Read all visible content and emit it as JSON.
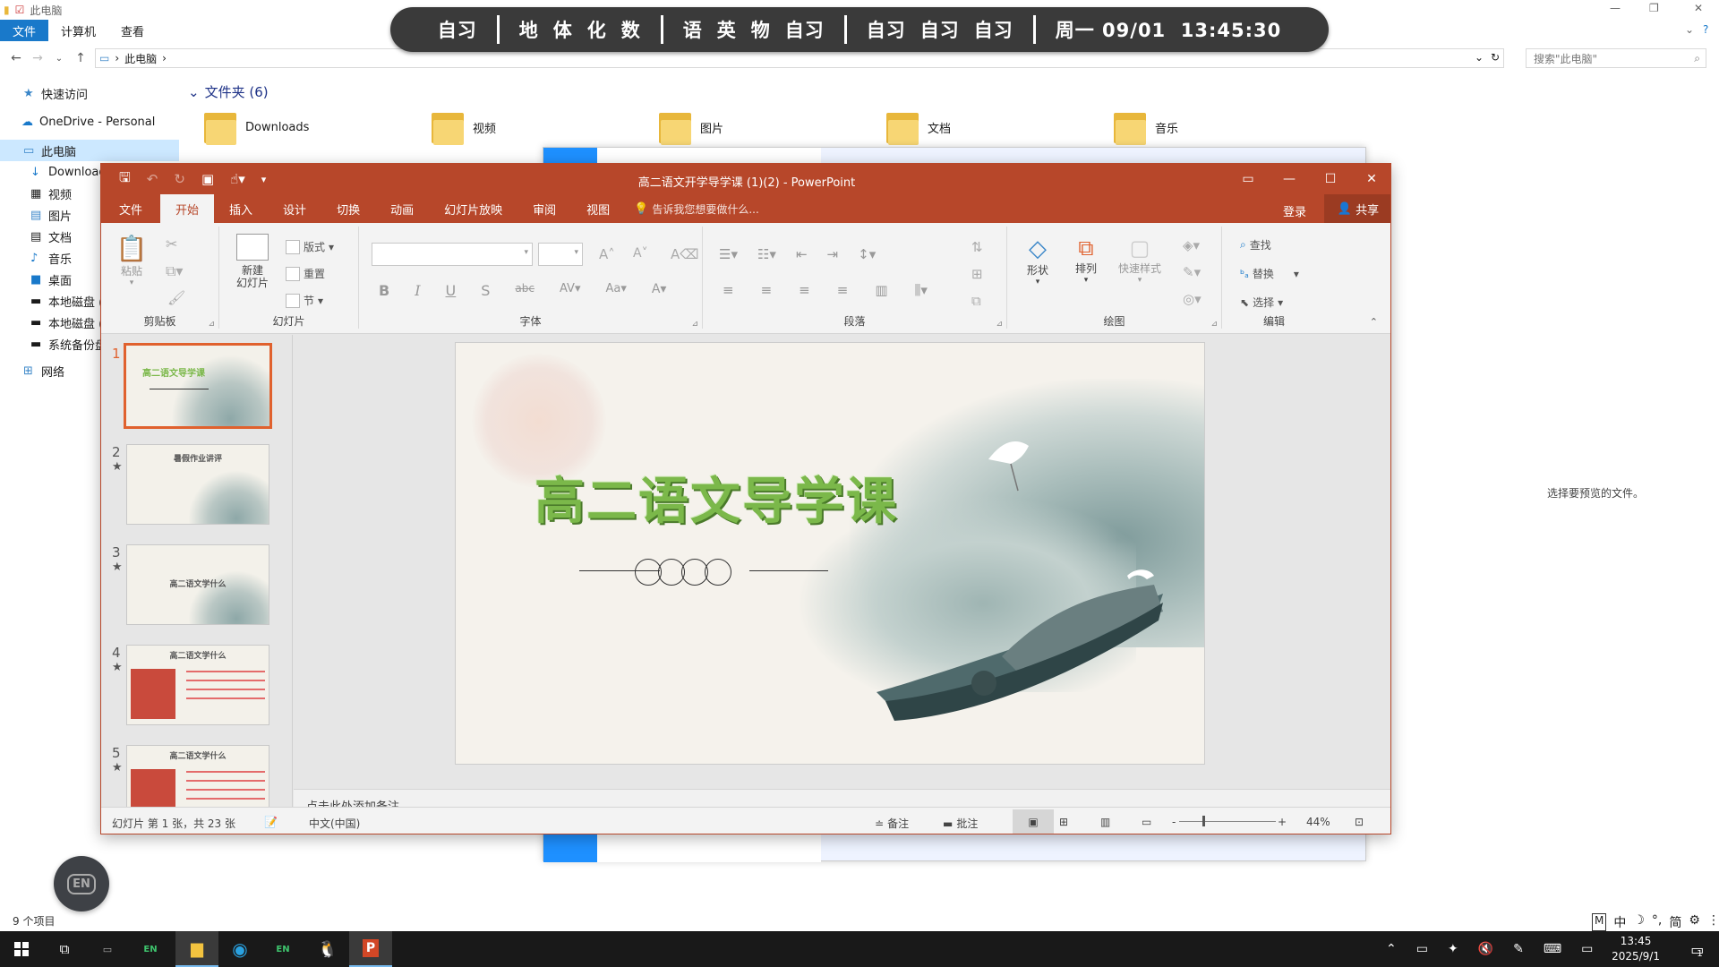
{
  "explorer": {
    "title": "此电脑",
    "tabs": [
      "文件",
      "计算机",
      "查看"
    ],
    "address": "此电脑",
    "search_placeholder": "搜索\"此电脑\"",
    "nav": [
      {
        "label": "快速访问",
        "icon": "star-icon"
      },
      {
        "label": "OneDrive - Personal",
        "icon": "cloud-icon"
      },
      {
        "label": "此电脑",
        "icon": "computer-icon"
      },
      {
        "label": "Download",
        "icon": "download-icon"
      },
      {
        "label": "视频",
        "icon": "video-icon"
      },
      {
        "label": "图片",
        "icon": "picture-icon"
      },
      {
        "label": "文档",
        "icon": "document-icon"
      },
      {
        "label": "音乐",
        "icon": "music-icon"
      },
      {
        "label": "桌面",
        "icon": "desktop-icon"
      },
      {
        "label": "本地磁盘 (C",
        "icon": "drive-icon"
      },
      {
        "label": "本地磁盘 (D",
        "icon": "drive-icon"
      },
      {
        "label": "系统备份盘",
        "icon": "drive-icon"
      },
      {
        "label": "网络",
        "icon": "network-icon"
      }
    ],
    "folders_header": "文件夹 (6)",
    "folders": [
      "Downloads",
      "视频",
      "图片",
      "文档",
      "音乐"
    ],
    "preview_message": "选择要预览的文件。",
    "item_count": "9 个项目"
  },
  "banner": {
    "groups": [
      [
        "自习"
      ],
      [
        "地",
        "体",
        "化",
        "数"
      ],
      [
        "语",
        "英",
        "物",
        "自习"
      ],
      [
        "自习",
        "自习",
        "自习"
      ]
    ],
    "datetime": "周一 09/01  13:45:30"
  },
  "ppt": {
    "title": "高二语文开学导学课 (1)(2) - PowerPoint",
    "tabs": [
      "文件",
      "开始",
      "插入",
      "设计",
      "切换",
      "动画",
      "幻灯片放映",
      "审阅",
      "视图"
    ],
    "active_tab": "开始",
    "tell_me": "告诉我您想要做什么...",
    "login": "登录",
    "share": "共享",
    "ribbon": {
      "clipboard": {
        "name": "剪贴板",
        "paste": "粘贴"
      },
      "slides": {
        "name": "幻灯片",
        "new_slide": "新建\n幻灯片",
        "layout": "版式",
        "reset": "重置",
        "section": "节"
      },
      "font": {
        "name": "字体"
      },
      "paragraph": {
        "name": "段落"
      },
      "drawing": {
        "name": "绘图",
        "shapes": "形状",
        "arrange": "排列",
        "quick_styles": "快速样式"
      },
      "editing": {
        "name": "编辑",
        "find": "查找",
        "replace": "替换",
        "select": "选择"
      }
    },
    "thumbnails": [
      {
        "num": "1",
        "title": "高二语文导学课",
        "star": ""
      },
      {
        "num": "2",
        "title": "暑假作业讲评",
        "star": "★"
      },
      {
        "num": "3",
        "title": "高二语文学什么",
        "star": "★"
      },
      {
        "num": "4",
        "title": "高二语文学什么",
        "star": "★"
      },
      {
        "num": "5",
        "title": "高二语文学什么",
        "star": "★"
      }
    ],
    "slide_title": "高二语文导学课",
    "notes_placeholder": "点击此处添加备注",
    "status": {
      "slide_info": "幻灯片 第 1 张，共 23 张",
      "language": "中文(中国)",
      "notes": "备注",
      "comments": "批注",
      "zoom": "44%"
    }
  },
  "float_button": "EN",
  "ime": [
    "M",
    "中",
    "简"
  ],
  "taskbar": {
    "time": "13:45",
    "date": "2025/9/1",
    "notification_count": "1"
  },
  "colors": {
    "ppt_accent": "#b7472a",
    "explorer_accent": "#1979ca",
    "slide_title": "#7bb84a"
  }
}
